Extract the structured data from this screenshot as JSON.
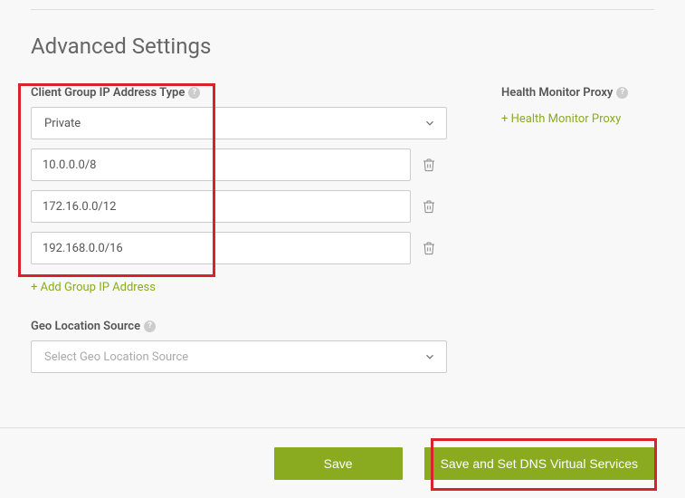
{
  "heading": "Advanced Settings",
  "client_group": {
    "label": "Client Group IP Address Type",
    "selected": "Private",
    "ips": [
      "10.0.0.0/8",
      "172.16.0.0/12",
      "192.168.0.0/16"
    ],
    "add_label": "+ Add Group IP Address"
  },
  "geo": {
    "label": "Geo Location Source",
    "placeholder": "Select Geo Location Source"
  },
  "health": {
    "label": "Health Monitor Proxy",
    "add_label": "+ Health Monitor Proxy"
  },
  "buttons": {
    "save": "Save",
    "save_set": "Save and Set DNS Virtual Services"
  }
}
